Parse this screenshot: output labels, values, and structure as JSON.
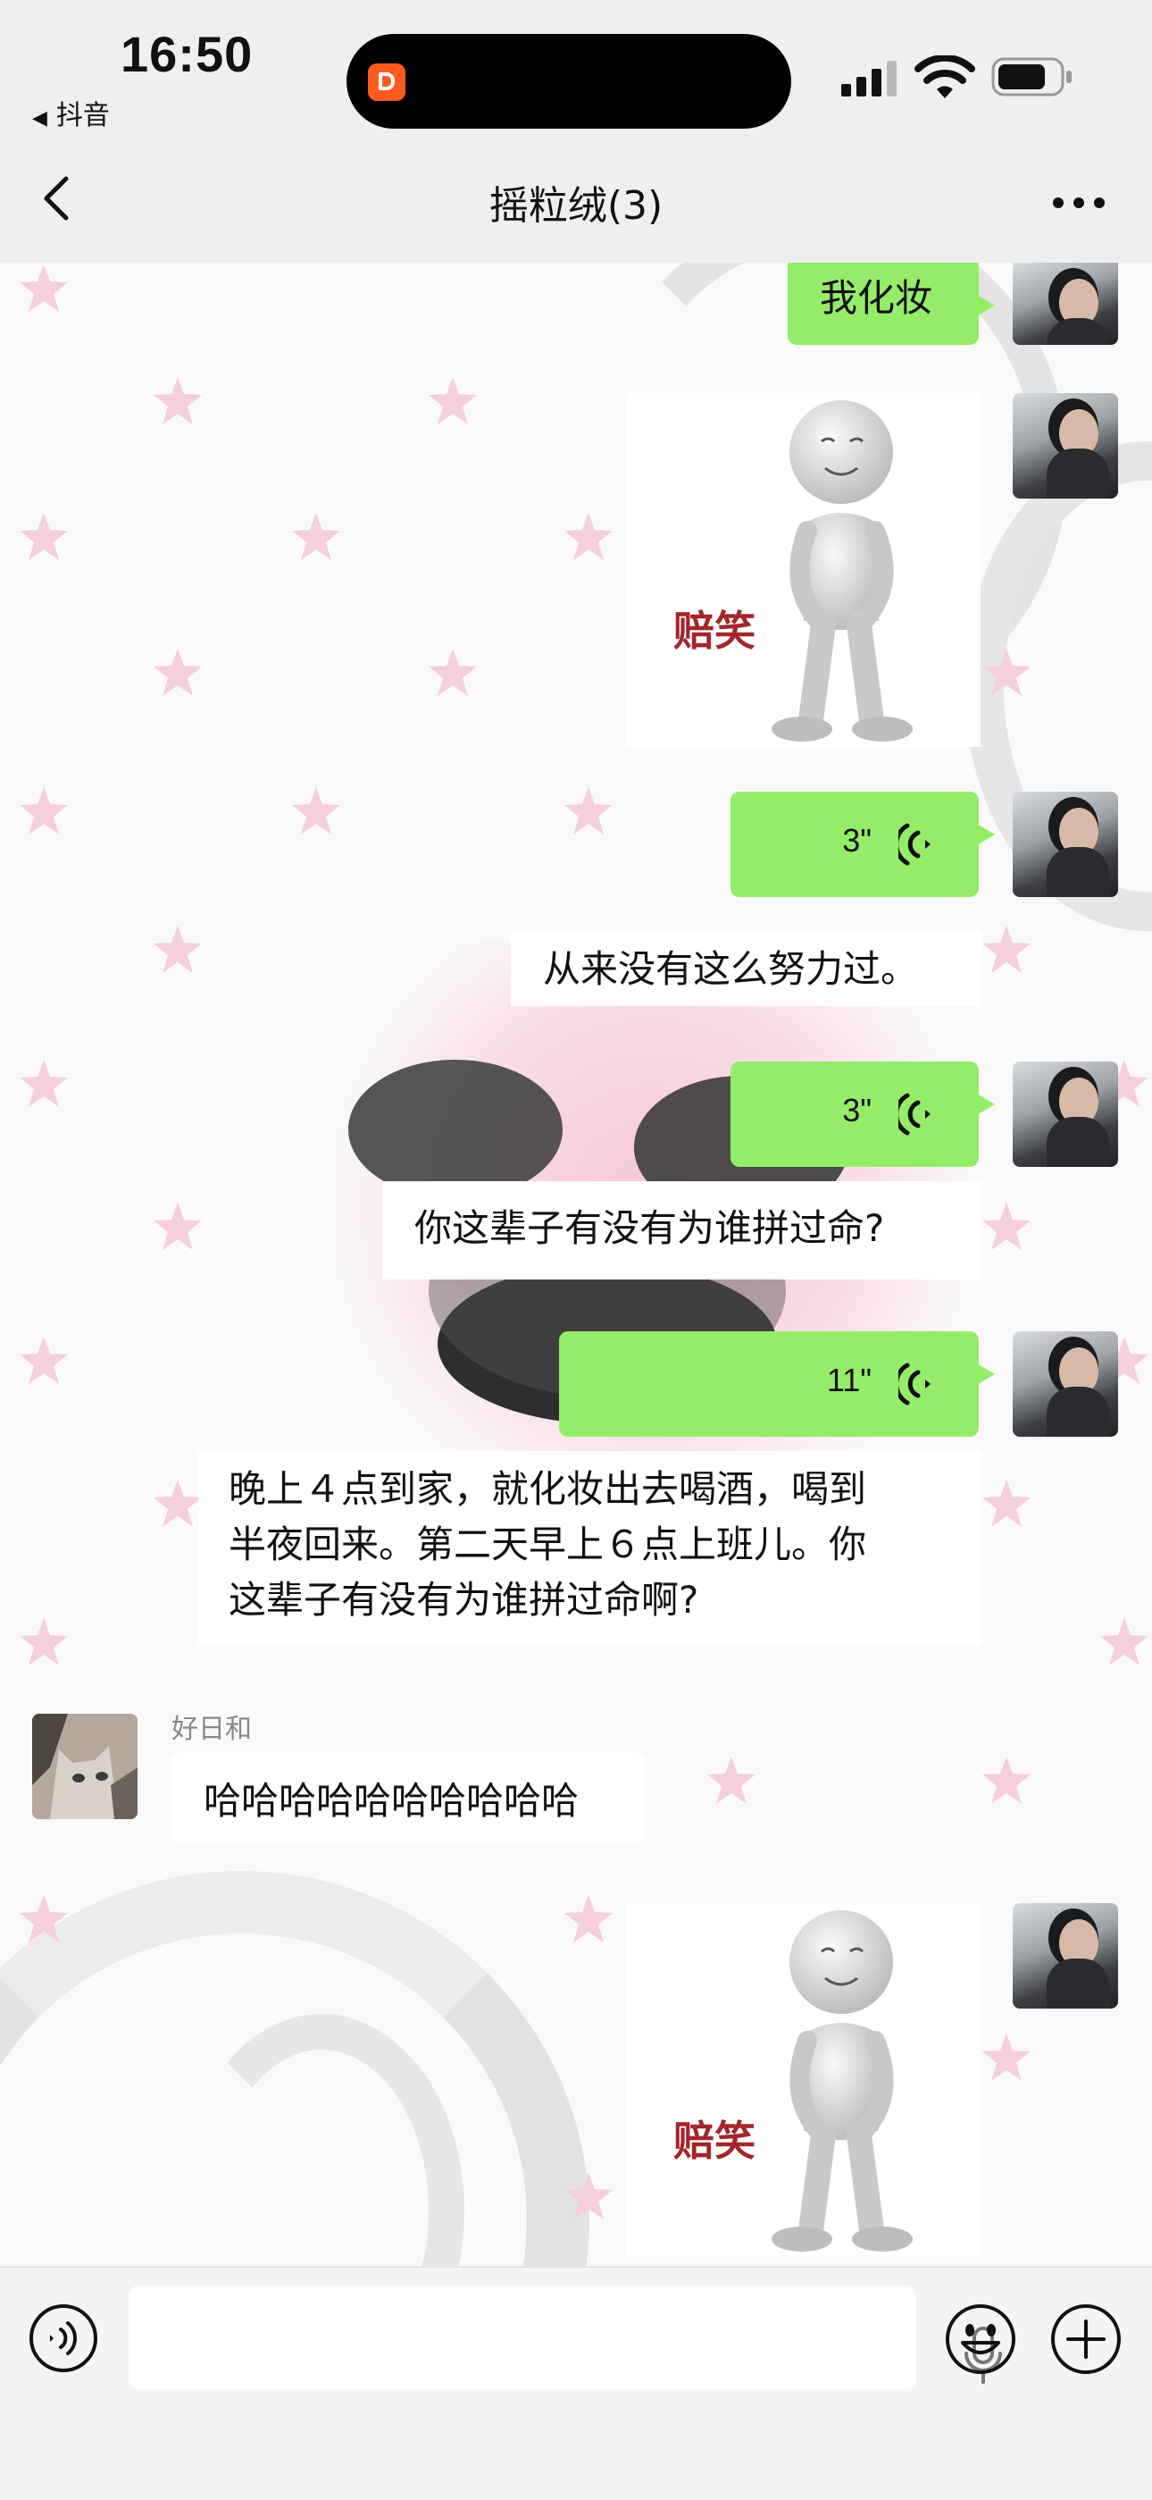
{
  "status_bar": {
    "time": "16:50",
    "back_app": "抖音"
  },
  "header": {
    "title": "摇粒绒(3)"
  },
  "messages": [
    {
      "type": "text_out",
      "text": "我化妆"
    },
    {
      "type": "sticker_out",
      "label": "赔笑"
    },
    {
      "type": "voice_out",
      "duration": "3\""
    },
    {
      "type": "transcript",
      "text": "从来没有这么努力过。"
    },
    {
      "type": "voice_out",
      "duration": "3\""
    },
    {
      "type": "transcript",
      "text": "你这辈子有没有为谁拼过命?"
    },
    {
      "type": "voice_out",
      "duration": "11\""
    },
    {
      "type": "transcript",
      "lines": [
        "晚上４点到家，就化妆出去喝酒，喝到",
        "半夜回来。第二天早上６点上班儿。你",
        "这辈子有没有为谁拼过命啊?"
      ]
    },
    {
      "type": "text_in",
      "sender": "好日和",
      "text": "哈哈哈哈哈哈哈哈哈哈"
    },
    {
      "type": "sticker_out",
      "label": "赔笑"
    }
  ],
  "colors": {
    "outgoing_bubble": "#95ec69",
    "background": "#fafafa",
    "sticker_text": "#a3262a"
  },
  "input_bar": {
    "icons": [
      "voice-toggle-icon",
      "mic-icon",
      "emoji-icon",
      "plus-icon"
    ]
  }
}
